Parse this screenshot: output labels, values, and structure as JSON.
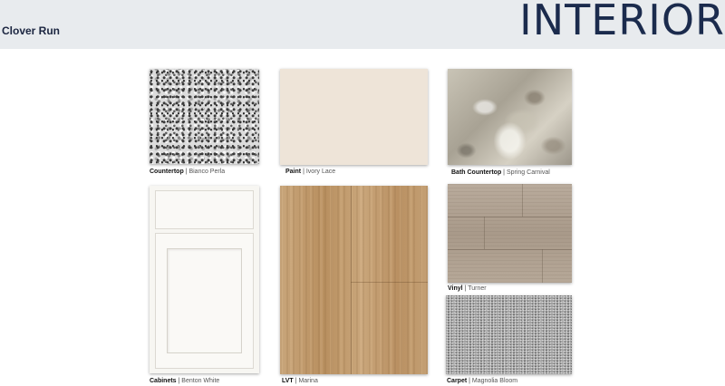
{
  "header": {
    "community": "Clover Run",
    "section": "INTERIOR"
  },
  "swatches": {
    "countertop": {
      "label": "Countertop",
      "separator": "|",
      "value": "Bianco Perla"
    },
    "paint": {
      "label": "Paint",
      "separator": "|",
      "value": "Ivory Lace"
    },
    "bath_countertop": {
      "label": "Bath Countertop",
      "separator": "|",
      "value": "Spring Carnival"
    },
    "cabinets": {
      "label": "Cabinets",
      "separator": "|",
      "value": "Benton White"
    },
    "lvt": {
      "label": "LVT",
      "separator": "|",
      "value": "Marina"
    },
    "vinyl": {
      "label": "Vinyl",
      "separator": "|",
      "value": "Turner"
    },
    "carpet": {
      "label": "Carpet",
      "separator": "|",
      "value": "Magnolia Bloom"
    }
  },
  "colors": {
    "header_bg": "#e8ebee",
    "title_navy": "#1b2b4d",
    "paint_ivory_lace": "#eee4d8"
  }
}
